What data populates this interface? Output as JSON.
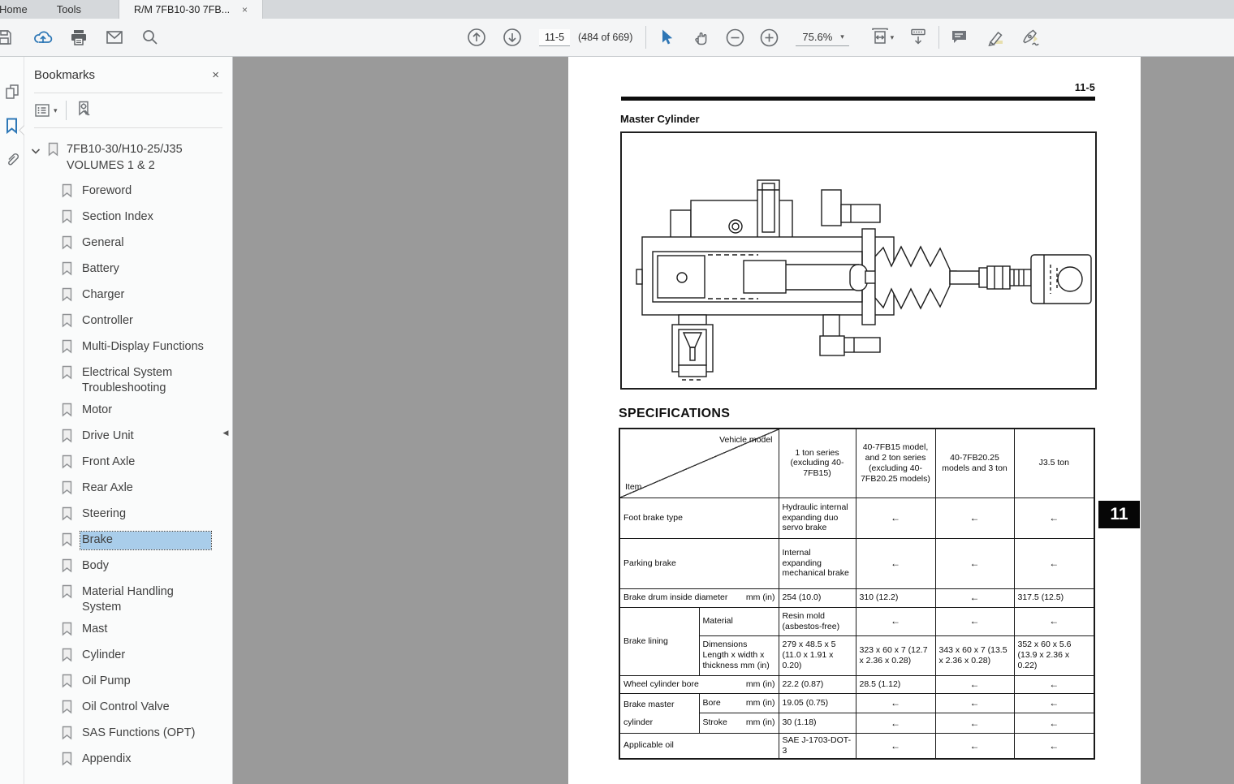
{
  "icons": {
    "close": "×",
    "dropdown": "▾",
    "collapse_left": "◀"
  },
  "tabs": {
    "home": "Home",
    "tools": "Tools",
    "document": "R/M 7FB10-30 7FB...",
    "close": "×"
  },
  "toolbar": {
    "page_input": "11-5",
    "page_count": "(484 of 669)",
    "zoom_value": "75.6%"
  },
  "sidebar": {
    "title": "Bookmarks",
    "root_label_line1": "7FB10-30/H10-25/J35",
    "root_label_line2": "VOLUMES 1 & 2",
    "items": [
      {
        "label": "Foreword"
      },
      {
        "label": "Section Index"
      },
      {
        "label": "General"
      },
      {
        "label": "Battery"
      },
      {
        "label": "Charger"
      },
      {
        "label": "Controller"
      },
      {
        "label": "Multi-Display Functions"
      },
      {
        "label": "Electrical System Troubleshooting"
      },
      {
        "label": "Motor"
      },
      {
        "label": "Drive Unit"
      },
      {
        "label": "Front Axle"
      },
      {
        "label": "Rear Axle"
      },
      {
        "label": "Steering"
      },
      {
        "label": "Brake",
        "selected": true
      },
      {
        "label": "Body"
      },
      {
        "label": "Material Handling System"
      },
      {
        "label": "Mast"
      },
      {
        "label": "Cylinder"
      },
      {
        "label": "Oil Pump"
      },
      {
        "label": "Oil Control Valve"
      },
      {
        "label": "SAS Functions (OPT)"
      },
      {
        "label": "Appendix"
      }
    ]
  },
  "document": {
    "page_number": "11-5",
    "title": "Master Cylinder",
    "section_heading": "SPECIFICATIONS",
    "section_tab": "11",
    "table": {
      "arrow": "←",
      "corner_top": "Vehicle model",
      "corner_bottom": "Item",
      "columns": [
        "1 ton series (excluding 40-7FB15)",
        "40-7FB15 model, and 2 ton series (excluding 40-7FB20.25 models)",
        "40-7FB20.25 models and 3 ton",
        "J3.5 ton"
      ],
      "rows": {
        "foot_brake": {
          "label": "Foot brake type",
          "v1": "Hydraulic internal expanding duo servo brake"
        },
        "parking_brake": {
          "label": "Parking brake",
          "v1": "Internal expanding mechanical brake"
        },
        "brake_drum": {
          "label": "Brake drum inside diameter",
          "unit": "mm (in)",
          "v1": "254 (10.0)",
          "v2": "310 (12.2)",
          "v4": "317.5 (12.5)"
        },
        "brake_lining": {
          "label": "Brake lining",
          "material": {
            "label": "Material",
            "v1": "Resin mold (asbestos-free)"
          },
          "dimensions": {
            "label": "Dimensions Length x width x thickness mm (in)",
            "v1": "279 x 48.5 x 5 (11.0 x 1.91 x 0.20)",
            "v2": "323 x 60 x 7 (12.7 x 2.36 x 0.28)",
            "v3": "343 x 60 x 7 (13.5 x 2.36 x 0.28)",
            "v4": "352 x 60 x 5.6 (13.9 x 2.36 x 0.22)"
          }
        },
        "wheel_cylinder": {
          "label": "Wheel cylinder bore",
          "unit": "mm (in)",
          "v1": "22.2 (0.87)",
          "v2": "28.5 (1.12)"
        },
        "master_cylinder": {
          "label": "Brake master cylinder",
          "bore": {
            "label": "Bore",
            "unit": "mm (in)",
            "v1": "19.05 (0.75)"
          },
          "stroke": {
            "label": "Stroke",
            "unit": "mm (in)",
            "v1": "30 (1.18)"
          }
        },
        "applicable_oil": {
          "label": "Applicable oil",
          "v1": "SAE J-1703-DOT-3"
        }
      }
    }
  }
}
